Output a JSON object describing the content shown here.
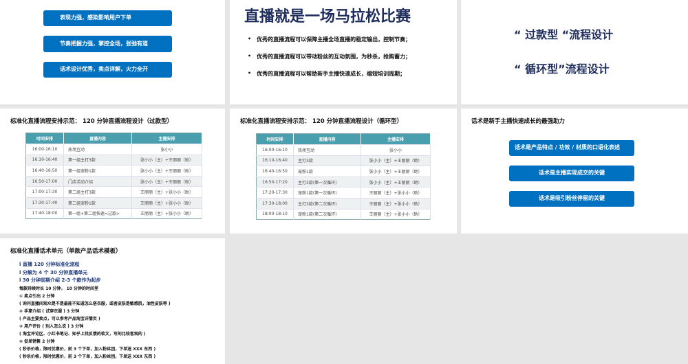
{
  "slide1": {
    "buttons": [
      "表现力强，感染影响用户下单",
      "节奏把握力强，掌控全场，张弛有道",
      "话术设计优秀，卖点详解，火力全开"
    ],
    "accent": "#0070c0"
  },
  "slide2": {
    "title": "直播就是一场马拉松比赛",
    "bullets": [
      "优秀的直播流程可以保障主播全场直播的稳定输出，控制节奏；",
      "优秀的直播流程可以带动粉丝的互动氛围，为秒杀，抢购蓄力；",
      "优秀的直播流程可以帮助新手主播快速成长，缩短培训周期；"
    ]
  },
  "slide3": {
    "lines": [
      "“ 过款型 “流程设计",
      "“ 循环型”流程设计"
    ]
  },
  "slide4": {
    "title": "标准化直播流程安排示范： 120 分钟直播流程设计（过款型）",
    "headers": [
      "时间安排",
      "直播内容",
      "主播安排"
    ],
    "rows": [
      [
        "16:00-16:10",
        "热场互动",
        "张小小"
      ],
      [
        "16:10-16:40",
        "第一组主打3款",
        "张小小（主）+王丽丽（助）"
      ],
      [
        "16:40-16:50",
        "第一组宠粉1款",
        "张小小（主）+王丽丽（助）"
      ],
      [
        "16:50-17:00",
        "门店活动介绍",
        "张小小（主）+王丽丽（助）"
      ],
      [
        "17:00-17:30",
        "第二组主打3款",
        "王丽丽（主）+张小小（助）"
      ],
      [
        "17:30-17:40",
        "第二组宠粉1款",
        "王丽丽（主）+张小小（助）"
      ],
      [
        "17:40-18:00",
        "第一组+第二组快速<过款>",
        "王丽丽（主）+张小小（助）"
      ]
    ]
  },
  "slide5": {
    "title": "标准化直播流程安排示范： 120 分钟直播流程设计（循环型）",
    "headers": [
      "时间安排",
      "直播内容",
      "主播安排"
    ],
    "rows": [
      [
        "16:00-16:10",
        "热场互动",
        "张小小"
      ],
      [
        "16:10-16:40",
        "主打3款",
        "张小小（主）+王丽丽（助）"
      ],
      [
        "16:40-16:50",
        "宠粉1款",
        "张小小（主）+王丽丽（助）"
      ],
      [
        "16:50-17:20",
        "主打3款(第一次循环)",
        "张小小（主）+王丽丽（助）"
      ],
      [
        "17:20-17:30",
        "宠粉1款(第一次循环)",
        "王丽丽（主）+张小小（助）"
      ],
      [
        "17:30-18:00",
        "主打3款(第二次循环)",
        "王丽丽（主）+张小小（助）"
      ],
      [
        "18:00-18:10",
        "宠粉1款(第二次循环)",
        "王丽丽（主）+张小小（助）"
      ]
    ]
  },
  "slide6": {
    "title": "话术是新手主播快速成长的最强助力",
    "buttons": [
      "话术是产品特点 / 功效 / 材质的口语化表述",
      "话术是主播实现成交的关键",
      "话术是吸引粉丝停留的关键"
    ]
  },
  "slide7": {
    "title": "标准化直播话术单元（单款产品话术模板）",
    "highlights": [
      "l 直播 120 分钟标准化流程",
      "l 分解为 4 个 30 分钟直播单元",
      "l 30 分钟前期介绍 2-3 个款作为起步"
    ],
    "lines": [
      "每款持续时长 10 分钟， 10 分钟的时间里",
      "① 卖点引出 2 分钟",
      "( 询问直播间观众是不是最能不知道怎么搭衣服，或者皮肤是敏感肌，油性皮肤等 )",
      "② 手拿介绍 ( 试穿衣服 ) 3 分钟",
      "( 产品主要卖点，可以参考产品淘宝详情页 )",
      "③ 用户评价 ( 别人怎么说 ) 3 分钟",
      "( 淘宝评论区、小红书笔记、知乎上找反馈的软文，写的比较客观的 )",
      "④ 促单销售 2 分钟",
      "( 秒杀价格，限时优惠价，前 3 个下单，加入粉丝团，下单送 XXX 东西 )",
      "( 秒杀价格，限时优惠价，前 3 个下单，加入粉丝团，下单送 XXX 东西 )"
    ]
  }
}
